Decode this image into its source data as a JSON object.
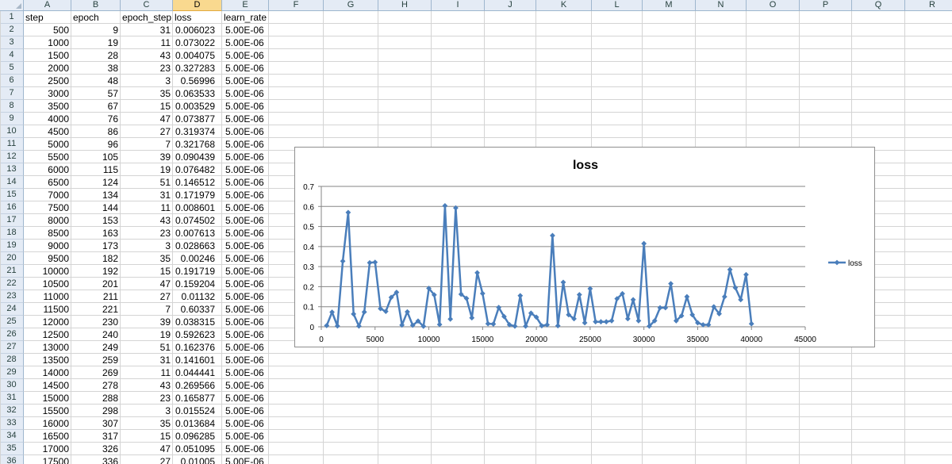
{
  "columns": [
    "A",
    "B",
    "C",
    "D",
    "E",
    "F",
    "G",
    "H",
    "I",
    "J",
    "K",
    "L",
    "M",
    "N",
    "O",
    "P",
    "Q",
    "R"
  ],
  "selected_column": "D",
  "rows": [
    {
      "n": "1",
      "cells": [
        "step",
        "epoch",
        "epoch_step",
        "loss",
        "learn_rate"
      ]
    },
    {
      "n": "2",
      "cells": [
        "500",
        "9",
        "31",
        "0.006023",
        "5.00E-06"
      ]
    },
    {
      "n": "3",
      "cells": [
        "1000",
        "19",
        "11",
        "0.073022",
        "5.00E-06"
      ]
    },
    {
      "n": "4",
      "cells": [
        "1500",
        "28",
        "43",
        "0.004075",
        "5.00E-06"
      ]
    },
    {
      "n": "5",
      "cells": [
        "2000",
        "38",
        "23",
        "0.327283",
        "5.00E-06"
      ]
    },
    {
      "n": "6",
      "cells": [
        "2500",
        "48",
        "3",
        "0.56996",
        "5.00E-06"
      ]
    },
    {
      "n": "7",
      "cells": [
        "3000",
        "57",
        "35",
        "0.063533",
        "5.00E-06"
      ]
    },
    {
      "n": "8",
      "cells": [
        "3500",
        "67",
        "15",
        "0.003529",
        "5.00E-06"
      ]
    },
    {
      "n": "9",
      "cells": [
        "4000",
        "76",
        "47",
        "0.073877",
        "5.00E-06"
      ]
    },
    {
      "n": "10",
      "cells": [
        "4500",
        "86",
        "27",
        "0.319374",
        "5.00E-06"
      ]
    },
    {
      "n": "11",
      "cells": [
        "5000",
        "96",
        "7",
        "0.321768",
        "5.00E-06"
      ]
    },
    {
      "n": "12",
      "cells": [
        "5500",
        "105",
        "39",
        "0.090439",
        "5.00E-06"
      ]
    },
    {
      "n": "13",
      "cells": [
        "6000",
        "115",
        "19",
        "0.076482",
        "5.00E-06"
      ]
    },
    {
      "n": "14",
      "cells": [
        "6500",
        "124",
        "51",
        "0.146512",
        "5.00E-06"
      ]
    },
    {
      "n": "15",
      "cells": [
        "7000",
        "134",
        "31",
        "0.171979",
        "5.00E-06"
      ]
    },
    {
      "n": "16",
      "cells": [
        "7500",
        "144",
        "11",
        "0.008601",
        "5.00E-06"
      ]
    },
    {
      "n": "17",
      "cells": [
        "8000",
        "153",
        "43",
        "0.074502",
        "5.00E-06"
      ]
    },
    {
      "n": "18",
      "cells": [
        "8500",
        "163",
        "23",
        "0.007613",
        "5.00E-06"
      ]
    },
    {
      "n": "19",
      "cells": [
        "9000",
        "173",
        "3",
        "0.028663",
        "5.00E-06"
      ]
    },
    {
      "n": "20",
      "cells": [
        "9500",
        "182",
        "35",
        "0.00246",
        "5.00E-06"
      ]
    },
    {
      "n": "21",
      "cells": [
        "10000",
        "192",
        "15",
        "0.191719",
        "5.00E-06"
      ]
    },
    {
      "n": "22",
      "cells": [
        "10500",
        "201",
        "47",
        "0.159204",
        "5.00E-06"
      ]
    },
    {
      "n": "23",
      "cells": [
        "11000",
        "211",
        "27",
        "0.01132",
        "5.00E-06"
      ]
    },
    {
      "n": "24",
      "cells": [
        "11500",
        "221",
        "7",
        "0.60337",
        "5.00E-06"
      ]
    },
    {
      "n": "25",
      "cells": [
        "12000",
        "230",
        "39",
        "0.038315",
        "5.00E-06"
      ]
    },
    {
      "n": "26",
      "cells": [
        "12500",
        "240",
        "19",
        "0.592623",
        "5.00E-06"
      ]
    },
    {
      "n": "27",
      "cells": [
        "13000",
        "249",
        "51",
        "0.162376",
        "5.00E-06"
      ]
    },
    {
      "n": "28",
      "cells": [
        "13500",
        "259",
        "31",
        "0.141601",
        "5.00E-06"
      ]
    },
    {
      "n": "29",
      "cells": [
        "14000",
        "269",
        "11",
        "0.044441",
        "5.00E-06"
      ]
    },
    {
      "n": "30",
      "cells": [
        "14500",
        "278",
        "43",
        "0.269566",
        "5.00E-06"
      ]
    },
    {
      "n": "31",
      "cells": [
        "15000",
        "288",
        "23",
        "0.165877",
        "5.00E-06"
      ]
    },
    {
      "n": "32",
      "cells": [
        "15500",
        "298",
        "3",
        "0.015524",
        "5.00E-06"
      ]
    },
    {
      "n": "33",
      "cells": [
        "16000",
        "307",
        "35",
        "0.013684",
        "5.00E-06"
      ]
    },
    {
      "n": "34",
      "cells": [
        "16500",
        "317",
        "15",
        "0.096285",
        "5.00E-06"
      ]
    },
    {
      "n": "35",
      "cells": [
        "17000",
        "326",
        "47",
        "0.051095",
        "5.00E-06"
      ]
    },
    {
      "n": "36",
      "cells": [
        "17500",
        "336",
        "27",
        "0.01005",
        "5.00E-06"
      ]
    }
  ],
  "chart_data": {
    "type": "line",
    "title": "loss",
    "legend": "right",
    "grid": true,
    "xlim": [
      0,
      45000
    ],
    "ylim": [
      0,
      0.7
    ],
    "xticks": [
      "0",
      "5000",
      "10000",
      "15000",
      "20000",
      "25000",
      "30000",
      "35000",
      "40000",
      "45000"
    ],
    "yticks": [
      "0",
      "0.1",
      "0.2",
      "0.3",
      "0.4",
      "0.5",
      "0.6",
      "0.7"
    ],
    "series": [
      {
        "name": "loss",
        "color": "#4a7ebb",
        "x": [
          500,
          1000,
          1500,
          2000,
          2500,
          3000,
          3500,
          4000,
          4500,
          5000,
          5500,
          6000,
          6500,
          7000,
          7500,
          8000,
          8500,
          9000,
          9500,
          10000,
          10500,
          11000,
          11500,
          12000,
          12500,
          13000,
          13500,
          14000,
          14500,
          15000,
          15500,
          16000,
          16500,
          17000,
          17500,
          18000,
          18500,
          19000,
          19500,
          20000,
          20500,
          21000,
          21500,
          22000,
          22500,
          23000,
          23500,
          24000,
          24500,
          25000,
          25500,
          26000,
          26500,
          27000,
          27500,
          28000,
          28500,
          29000,
          29500,
          30000,
          30500,
          31000,
          31500,
          32000,
          32500,
          33000,
          33500,
          34000,
          34500,
          35000,
          35500,
          36000,
          36500,
          37000,
          37500,
          38000,
          38500,
          39000,
          39500,
          40000
        ],
        "y": [
          0.006023,
          0.073022,
          0.004075,
          0.327283,
          0.56996,
          0.063533,
          0.003529,
          0.073877,
          0.319374,
          0.321768,
          0.090439,
          0.076482,
          0.146512,
          0.171979,
          0.008601,
          0.074502,
          0.007613,
          0.028663,
          0.00246,
          0.191719,
          0.159204,
          0.01132,
          0.60337,
          0.038315,
          0.592623,
          0.162376,
          0.141601,
          0.044441,
          0.269566,
          0.165877,
          0.015524,
          0.013684,
          0.096285,
          0.051095,
          0.01005,
          0.003,
          0.155,
          0.003,
          0.068,
          0.048,
          0.005,
          0.01,
          0.455,
          0.005,
          0.222,
          0.06,
          0.04,
          0.16,
          0.02,
          0.19,
          0.025,
          0.025,
          0.025,
          0.03,
          0.14,
          0.165,
          0.04,
          0.135,
          0.03,
          0.415,
          0.003,
          0.03,
          0.095,
          0.095,
          0.215,
          0.03,
          0.055,
          0.15,
          0.06,
          0.02,
          0.01,
          0.01,
          0.1,
          0.065,
          0.15,
          0.285,
          0.195,
          0.135,
          0.26,
          0.015
        ]
      }
    ]
  }
}
